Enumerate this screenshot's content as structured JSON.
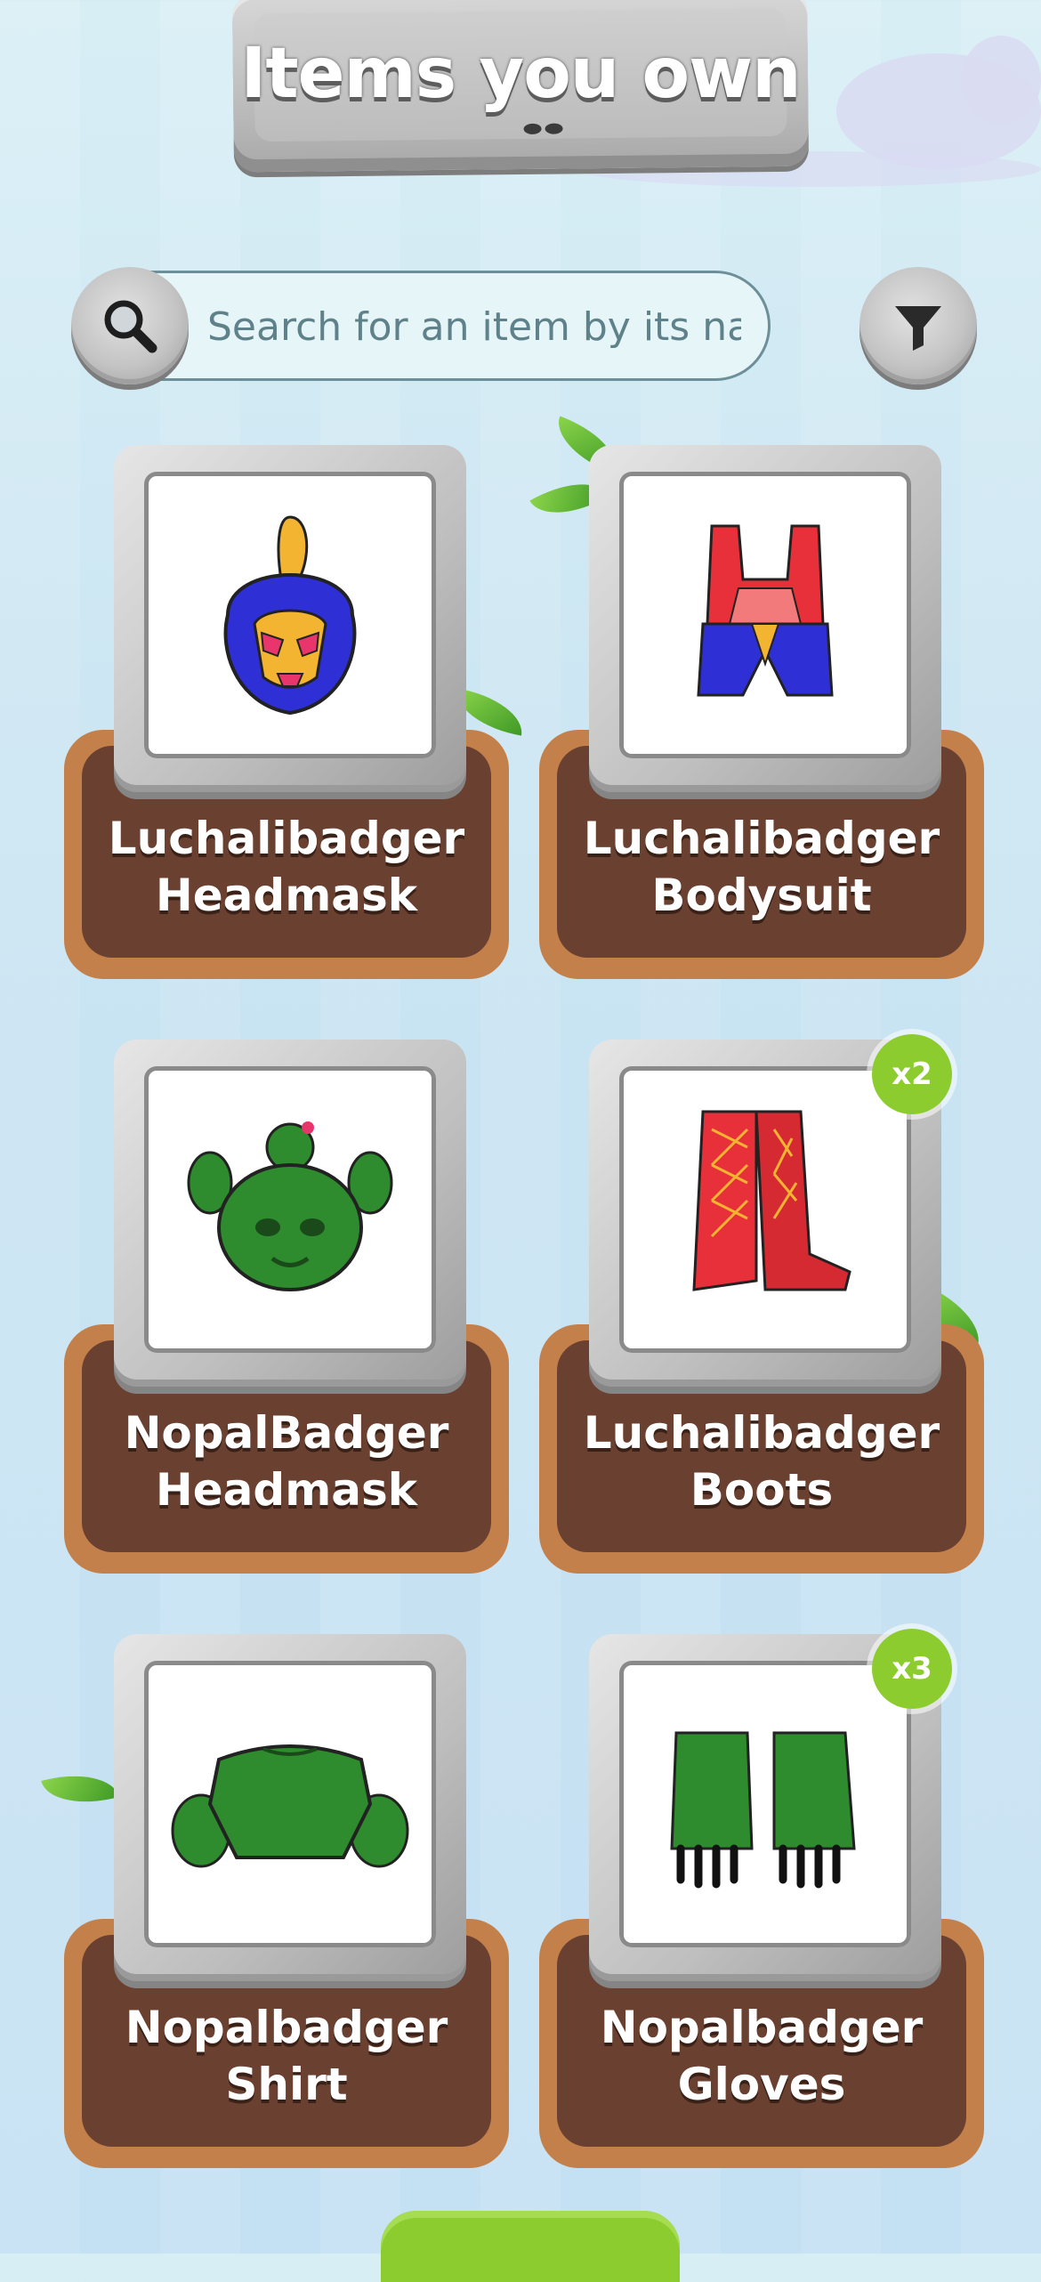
{
  "header": {
    "title": "Items you own"
  },
  "search": {
    "placeholder": "Search for an item by its name"
  },
  "items": [
    {
      "line1": "Luchalibadger",
      "line2": "Headmask",
      "icon": "lucha-headmask-icon"
    },
    {
      "line1": "Luchalibadger",
      "line2": "Bodysuit",
      "icon": "lucha-bodysuit-icon"
    },
    {
      "line1": "NopalBadger",
      "line2": "Headmask",
      "icon": "cactus-headmask-icon"
    },
    {
      "line1": "Luchalibadger",
      "line2": "Boots",
      "icon": "red-boots-icon",
      "count": "x2"
    },
    {
      "line1": "Nopalbadger",
      "line2": "Shirt",
      "icon": "cactus-shirt-icon"
    },
    {
      "line1": "Nopalbadger",
      "line2": "Gloves",
      "icon": "cactus-gloves-icon",
      "count": "x3"
    }
  ],
  "colors": {
    "badge": "#8ccc2e",
    "plaque_base": "#6a4030",
    "plaque_rim": "#c4804a"
  }
}
